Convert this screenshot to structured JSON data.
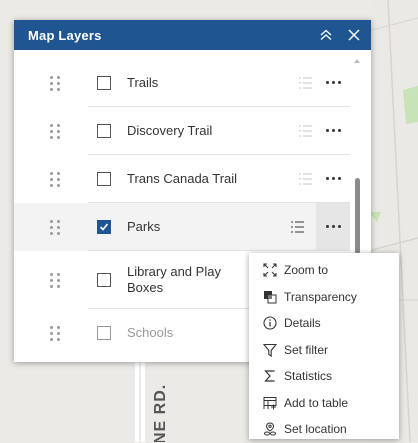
{
  "map": {
    "road_label": "NE RD."
  },
  "panel": {
    "title": "Map Layers",
    "collapse_icon": "double-chevron-up-icon",
    "close_icon": "close-icon",
    "header_color": "#1f5691"
  },
  "layers": [
    {
      "label": "Trails",
      "checked": false,
      "muted": false
    },
    {
      "label": "Discovery Trail",
      "checked": false,
      "muted": false
    },
    {
      "label": "Trans Canada Trail",
      "checked": false,
      "muted": false
    },
    {
      "label": "Parks",
      "checked": true,
      "muted": false
    },
    {
      "label": "Library and Play Boxes",
      "checked": false,
      "muted": false
    },
    {
      "label": "Schools",
      "checked": false,
      "muted": true
    }
  ],
  "menu": {
    "items": [
      {
        "label": "Zoom to",
        "icon": "zoom-to-icon"
      },
      {
        "label": "Transparency",
        "icon": "transparency-icon"
      },
      {
        "label": "Details",
        "icon": "info-icon"
      },
      {
        "label": "Set filter",
        "icon": "filter-icon"
      },
      {
        "label": "Statistics",
        "icon": "sigma-icon"
      },
      {
        "label": "Add to table",
        "icon": "add-table-icon"
      },
      {
        "label": "Set location",
        "icon": "set-location-icon"
      }
    ]
  }
}
